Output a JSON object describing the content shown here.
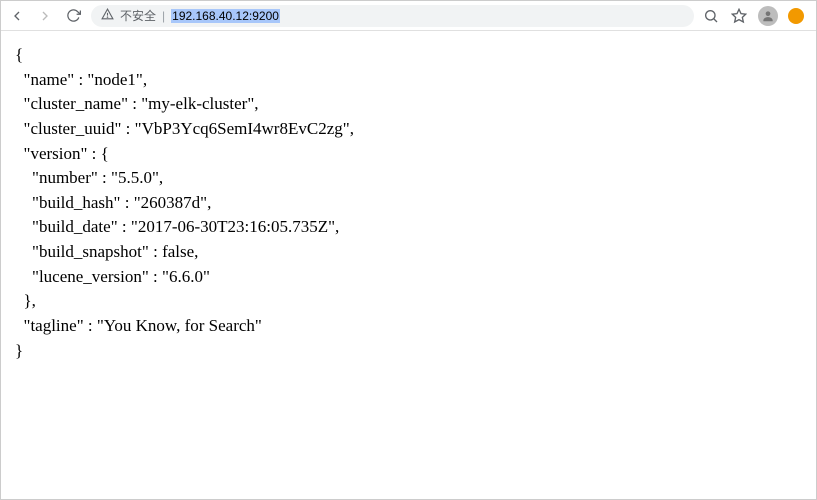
{
  "toolbar": {
    "not_secure_label": "不安全",
    "url": "192.168.40.12:9200"
  },
  "response": {
    "name": "node1",
    "cluster_name": "my-elk-cluster",
    "cluster_uuid": "VbP3Ycq6SemI4wr8EvC2zg",
    "version": {
      "number": "5.5.0",
      "build_hash": "260387d",
      "build_date": "2017-06-30T23:16:05.735Z",
      "build_snapshot": "false",
      "lucene_version": "6.6.0"
    },
    "tagline": "You Know, for Search"
  }
}
